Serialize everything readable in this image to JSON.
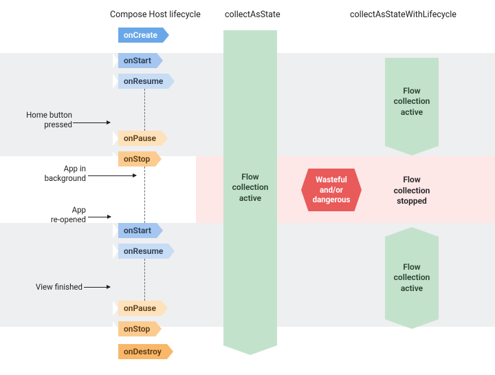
{
  "headers": {
    "lifecycle": "Compose Host lifecycle",
    "collectAsState": "collectAsState",
    "collectAsStateWithLifecycle": "collectAsStateWithLifecycle"
  },
  "lifecycle": [
    {
      "name": "onCreate",
      "color": "blue-d"
    },
    {
      "name": "onStart",
      "color": "blue-m"
    },
    {
      "name": "onResume",
      "color": "blue-l"
    },
    {
      "name": "onPause",
      "color": "orange-l"
    },
    {
      "name": "onStop",
      "color": "orange-m"
    },
    {
      "name": "onStart",
      "color": "blue-m"
    },
    {
      "name": "onResume",
      "color": "blue-l"
    },
    {
      "name": "onPause",
      "color": "orange-l"
    },
    {
      "name": "onStop",
      "color": "orange-m"
    },
    {
      "name": "onDestroy",
      "color": "orange-d"
    }
  ],
  "annotations": {
    "homeButton": "Home button\npressed",
    "appBackground": "App in\nbackground",
    "appReopened": "App\nre-opened",
    "viewFinished": "View finished"
  },
  "labels": {
    "flowActive": "Flow\ncollection\nactive",
    "flowStopped": "Flow\ncollection\nstopped",
    "dangerous": "Wasteful\nand/or\ndangerous"
  }
}
